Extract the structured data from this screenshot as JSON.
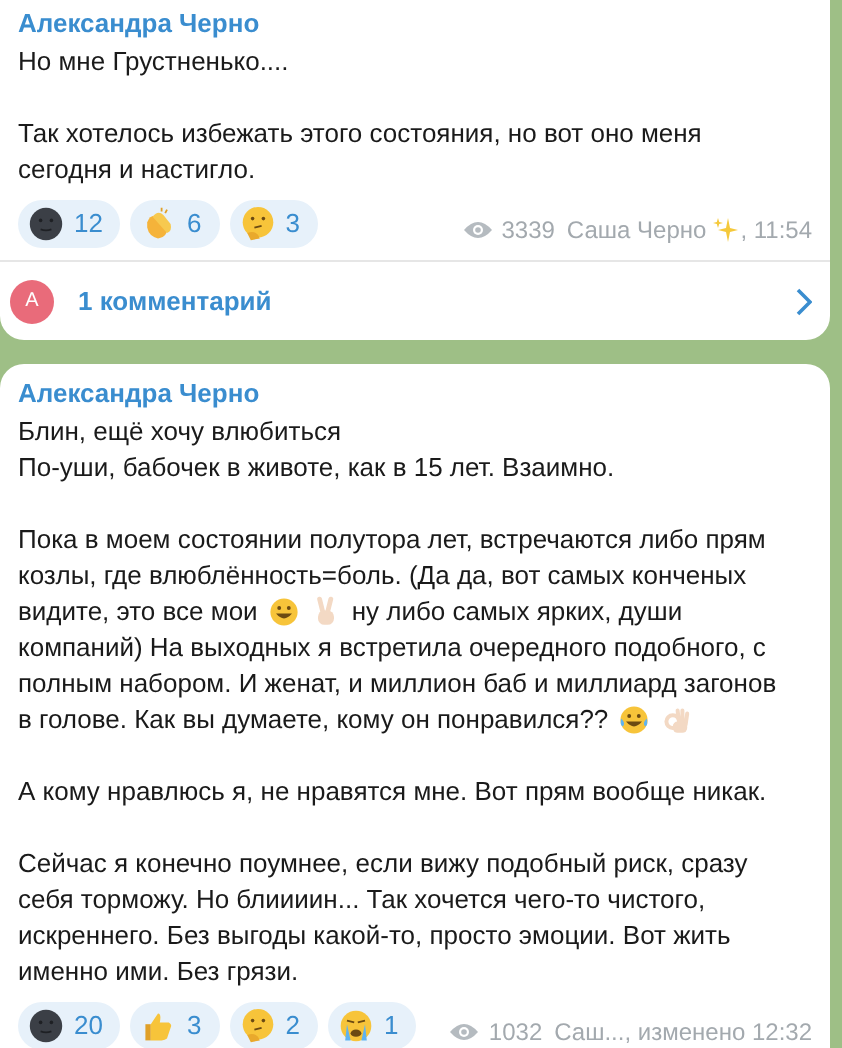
{
  "posts": [
    {
      "author": "Александра Черно",
      "paragraphs": [
        [
          [
            {
              "kind": "text",
              "text": "Но мне Грустненько...."
            }
          ]
        ],
        [
          [
            {
              "kind": "text",
              "text": "Так хотелось избежать этого состояния, но вот оно меня"
            }
          ],
          [
            {
              "kind": "text",
              "text": "сегодня и настигло."
            }
          ]
        ]
      ],
      "reactions": [
        {
          "kind": "moon",
          "count": "12"
        },
        {
          "kind": "clap",
          "count": "6"
        },
        {
          "kind": "thinking",
          "count": "3"
        }
      ],
      "views": "3339",
      "signature": "Саша Черно",
      "sparkle": true,
      "time": ", 11:54",
      "comments": {
        "avatar": "А",
        "label": "1 комментарий"
      }
    },
    {
      "author": "Александра Черно",
      "paragraphs": [
        [
          [
            {
              "kind": "text",
              "text": "Блин, ещё хочу влюбиться"
            }
          ],
          [
            {
              "kind": "text",
              "text": "По-уши, бабочек в животе, как в 15 лет. Взаимно."
            }
          ]
        ],
        [
          [
            {
              "kind": "text",
              "text": "Пока в моем состоянии полутора лет, встречаются либо прям"
            }
          ],
          [
            {
              "kind": "text",
              "text": "козлы, где влюблённость=боль. (Да да, вот самых конченых"
            }
          ],
          [
            {
              "kind": "text",
              "text": "видите, это все мои"
            },
            {
              "kind": "grin"
            },
            {
              "kind": "victory"
            },
            {
              "kind": "text",
              "text": "ну либо самых ярких, души"
            }
          ],
          [
            {
              "kind": "text",
              "text": "компаний) На выходных я встретила очередного подобного, с"
            }
          ],
          [
            {
              "kind": "text",
              "text": "полным набором. И женат, и миллион баб и миллиард загонов"
            }
          ],
          [
            {
              "kind": "text",
              "text": "в голове. Как вы думаете, кому он понравился??"
            },
            {
              "kind": "laugh"
            },
            {
              "kind": "ok"
            }
          ]
        ],
        [
          [
            {
              "kind": "text",
              "text": "А кому нравлюсь я, не нравятся мне. Вот прям вообще никак."
            }
          ]
        ],
        [
          [
            {
              "kind": "text",
              "text": "Сейчас я конечно поумнее, если вижу подобный риск, сразу"
            }
          ],
          [
            {
              "kind": "text",
              "text": "себя торможу. Но блиииин... Так хочется чего-то чистого,"
            }
          ],
          [
            {
              "kind": "text",
              "text": "искреннего. Без выгоды какой-то, просто эмоции. Вот жить"
            }
          ],
          [
            {
              "kind": "text",
              "text": "именно ими. Без грязи."
            }
          ]
        ]
      ],
      "reactions": [
        {
          "kind": "moon",
          "count": "20"
        },
        {
          "kind": "thumbs",
          "count": "3"
        },
        {
          "kind": "thinking",
          "count": "2"
        },
        {
          "kind": "crying",
          "count": "1"
        }
      ],
      "views": "1032",
      "signature": "Саш...",
      "sparkle": false,
      "time": ", изменено 12:32"
    }
  ]
}
